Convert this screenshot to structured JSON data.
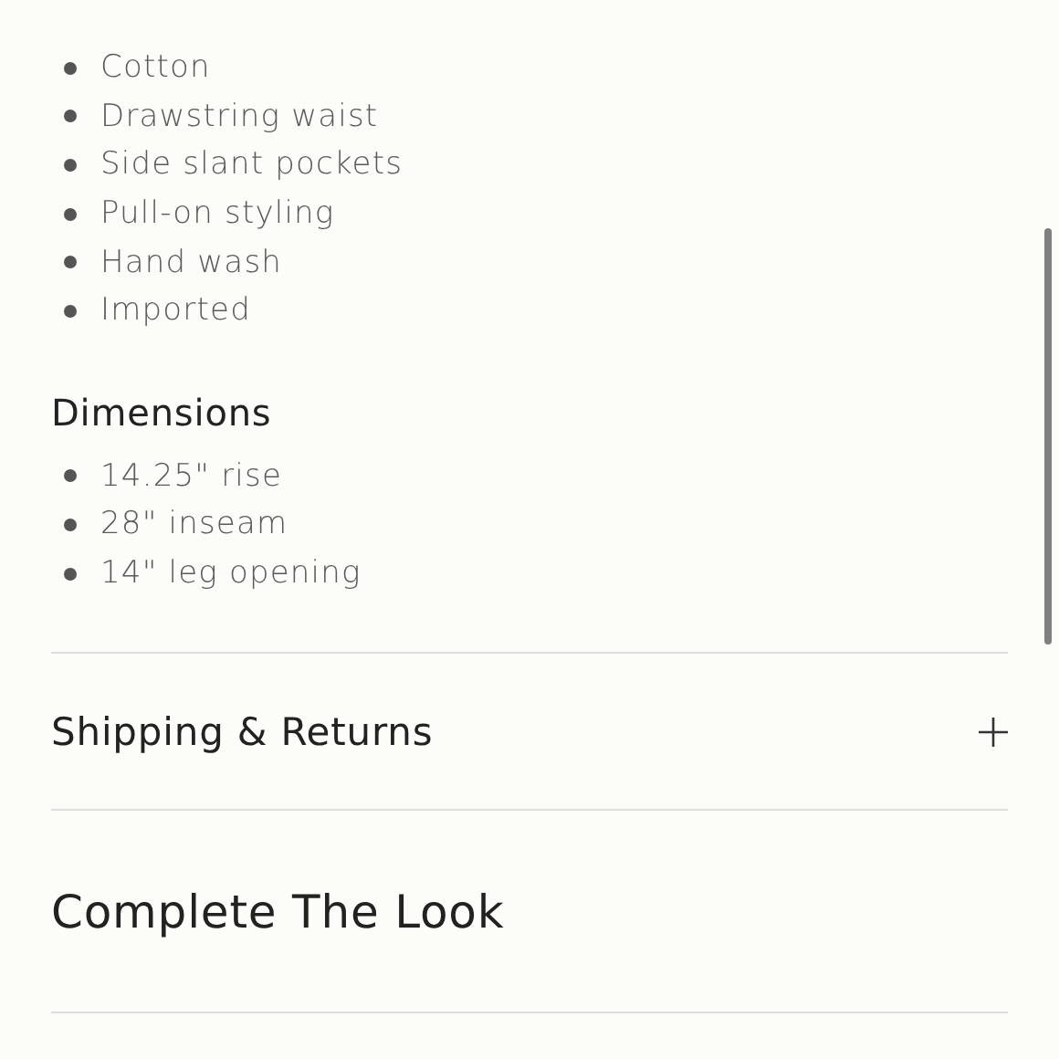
{
  "features": [
    "Cotton",
    "Drawstring waist",
    "Side slant pockets",
    "Pull-on styling",
    "Hand wash",
    "Imported"
  ],
  "dimensions": {
    "heading": "Dimensions",
    "items": [
      "14.25\" rise",
      "28\" inseam",
      "14\" leg opening"
    ]
  },
  "accordion": {
    "title": "Shipping & Returns",
    "expanded": false
  },
  "complete_the_look": {
    "heading": "Complete The Look"
  }
}
